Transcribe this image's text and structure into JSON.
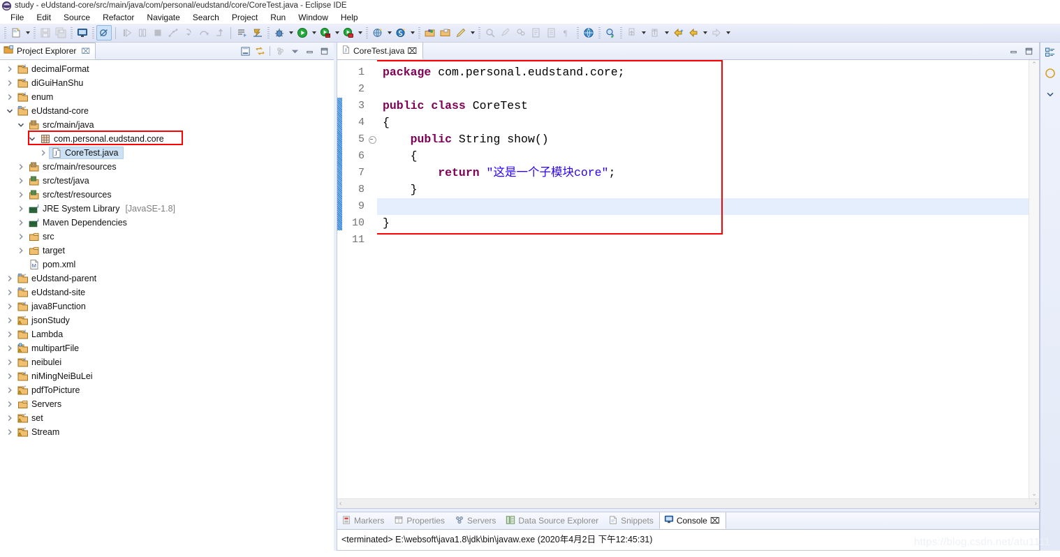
{
  "window": {
    "title": "study - eUdstand-core/src/main/java/com/personal/eudstand/core/CoreTest.java - Eclipse IDE",
    "app_icon": "eclipse-icon"
  },
  "menubar": {
    "items": [
      {
        "label": "File"
      },
      {
        "label": "Edit"
      },
      {
        "label": "Source"
      },
      {
        "label": "Refactor"
      },
      {
        "label": "Navigate"
      },
      {
        "label": "Search"
      },
      {
        "label": "Project"
      },
      {
        "label": "Run"
      },
      {
        "label": "Window"
      },
      {
        "label": "Help"
      }
    ]
  },
  "toolbar": {
    "groups": [
      {
        "buttons": [
          {
            "icon": "new-wizard-icon",
            "label": "New",
            "dropdown": true,
            "enabled": true,
            "active": false
          }
        ]
      },
      {
        "buttons": [
          {
            "icon": "save-icon",
            "label": "Save",
            "dropdown": false,
            "enabled": false,
            "active": false
          },
          {
            "icon": "save-all-icon",
            "label": "Save All",
            "dropdown": false,
            "enabled": false,
            "active": false
          }
        ]
      },
      {
        "buttons": [
          {
            "icon": "terminal-icon",
            "label": "Open Terminal",
            "dropdown": false,
            "enabled": true,
            "active": false
          }
        ]
      },
      {
        "buttons": [
          {
            "icon": "skip-breakpoints-icon",
            "label": "Skip All Breakpoints",
            "dropdown": false,
            "enabled": true,
            "active": true
          }
        ]
      },
      {
        "buttons": [
          {
            "icon": "resume-icon",
            "label": "Resume",
            "dropdown": false,
            "enabled": false,
            "active": false
          },
          {
            "icon": "suspend-icon",
            "label": "Suspend",
            "dropdown": false,
            "enabled": false,
            "active": false
          },
          {
            "icon": "terminate-icon",
            "label": "Terminate",
            "dropdown": false,
            "enabled": false,
            "active": false
          },
          {
            "icon": "disconnect-icon",
            "label": "Disconnect",
            "dropdown": false,
            "enabled": false,
            "active": false
          },
          {
            "icon": "step-into-icon",
            "label": "Step Into",
            "dropdown": false,
            "enabled": false,
            "active": false
          },
          {
            "icon": "step-over-icon",
            "label": "Step Over",
            "dropdown": false,
            "enabled": false,
            "active": false
          },
          {
            "icon": "step-return-icon",
            "label": "Step Return",
            "dropdown": false,
            "enabled": false,
            "active": false
          }
        ]
      },
      {
        "buttons": [
          {
            "icon": "next-annotation-icon",
            "label": "Next Annotation",
            "dropdown": false,
            "enabled": true,
            "active": false
          },
          {
            "icon": "last-edit-location-icon",
            "label": "Last Edit Location",
            "dropdown": false,
            "enabled": true,
            "active": false
          }
        ]
      },
      {
        "buttons": [
          {
            "icon": "debug-icon",
            "label": "Debug",
            "dropdown": true,
            "enabled": true,
            "active": false
          },
          {
            "icon": "run-icon",
            "label": "Run",
            "dropdown": true,
            "enabled": true,
            "active": false
          },
          {
            "icon": "run-external-tools-icon",
            "label": "External Tools",
            "dropdown": true,
            "enabled": true,
            "active": false
          },
          {
            "icon": "run-coverage-icon",
            "label": "Coverage",
            "dropdown": true,
            "enabled": true,
            "active": false
          }
        ]
      },
      {
        "buttons": [
          {
            "icon": "new-server-icon",
            "label": "New Server",
            "dropdown": false,
            "enabled": true,
            "active": false
          },
          {
            "icon": "new-web-project-icon",
            "label": "New Web Project",
            "dropdown": true,
            "enabled": true,
            "active": false
          },
          {
            "icon": "new-spring-icon",
            "label": "New Spring Element",
            "dropdown": true,
            "enabled": true,
            "active": false
          }
        ]
      },
      {
        "buttons": [
          {
            "icon": "new-java-package-icon",
            "label": "New Java Package",
            "dropdown": false,
            "enabled": true,
            "active": false
          },
          {
            "icon": "new-folder-icon",
            "label": "New Folder",
            "dropdown": false,
            "enabled": true,
            "active": false
          },
          {
            "icon": "new-class-icon",
            "label": "New Java Class",
            "dropdown": true,
            "enabled": true,
            "active": false
          }
        ]
      },
      {
        "buttons": [
          {
            "icon": "search-icon",
            "label": "Search",
            "dropdown": false,
            "enabled": false,
            "active": false
          },
          {
            "icon": "marker-icon",
            "label": "Toggle Marker",
            "dropdown": false,
            "enabled": false,
            "active": false
          },
          {
            "icon": "pin-icon",
            "label": "Pin Editor",
            "dropdown": false,
            "enabled": false,
            "active": false
          },
          {
            "icon": "open-task-icon",
            "label": "Open Task",
            "dropdown": false,
            "enabled": false,
            "active": false
          },
          {
            "icon": "block-selection-icon",
            "label": "Toggle Block Selection",
            "dropdown": false,
            "enabled": false,
            "active": false
          },
          {
            "icon": "whitespace-icon",
            "label": "Show Whitespace Characters",
            "dropdown": false,
            "enabled": false,
            "active": false
          }
        ]
      },
      {
        "buttons": [
          {
            "icon": "open-web-browser-icon",
            "label": "Open Web Browser",
            "dropdown": false,
            "enabled": true,
            "active": false
          }
        ]
      },
      {
        "buttons": [
          {
            "icon": "open-type-icon",
            "label": "Open Type",
            "dropdown": false,
            "enabled": true,
            "active": false
          }
        ]
      },
      {
        "buttons": [
          {
            "icon": "previous-annotation-icon",
            "label": "Previous Annotation",
            "dropdown": true,
            "enabled": false,
            "active": false
          },
          {
            "icon": "next-edit-icon",
            "label": "Next Annotation",
            "dropdown": true,
            "enabled": false,
            "active": false
          }
        ]
      },
      {
        "buttons": [
          {
            "icon": "back-history-icon",
            "label": "Back",
            "dropdown": false,
            "enabled": true,
            "active": false
          },
          {
            "icon": "back-icon",
            "label": "Back to",
            "dropdown": true,
            "enabled": true,
            "active": false
          },
          {
            "icon": "forward-icon",
            "label": "Forward",
            "dropdown": true,
            "enabled": false,
            "active": false
          }
        ]
      }
    ]
  },
  "project_explorer": {
    "tab_label": "Project Explorer",
    "tab_icon": "project-explorer-icon",
    "close_label": "⌧",
    "tools": [
      {
        "icon": "collapse-all-icon",
        "label": "Collapse All"
      },
      {
        "icon": "link-with-editor-icon",
        "label": "Link with Editor"
      },
      {
        "icon": "view-menu-dots-icon",
        "label": "View Menu"
      },
      {
        "icon": "view-menu-icon",
        "label": "View Menu"
      },
      {
        "icon": "minimize-icon",
        "label": "Minimize"
      },
      {
        "icon": "maximize-icon",
        "label": "Maximize"
      }
    ],
    "tree": [
      {
        "label": "decimalFormat",
        "indent": 0,
        "icon": "java-project-icon",
        "state": "collapsed"
      },
      {
        "label": "diGuiHanShu",
        "indent": 0,
        "icon": "java-project-icon",
        "state": "collapsed"
      },
      {
        "label": "enum",
        "indent": 0,
        "icon": "java-project-icon",
        "state": "collapsed"
      },
      {
        "label": "eUdstand-core",
        "indent": 0,
        "icon": "maven-project-icon",
        "state": "expanded"
      },
      {
        "label": "src/main/java",
        "indent": 1,
        "icon": "source-folder-icon",
        "state": "expanded"
      },
      {
        "label": "com.personal.eudstand.core",
        "indent": 2,
        "icon": "package-icon",
        "state": "expanded",
        "highlight_box": true
      },
      {
        "label": "CoreTest.java",
        "indent": 3,
        "icon": "java-file-icon",
        "state": "collapsed",
        "selected": true
      },
      {
        "label": "src/main/resources",
        "indent": 1,
        "icon": "source-folder-icon",
        "state": "collapsed"
      },
      {
        "label": "src/test/java",
        "indent": 1,
        "icon": "source-folder-green-icon",
        "state": "collapsed"
      },
      {
        "label": "src/test/resources",
        "indent": 1,
        "icon": "source-folder-green-icon",
        "state": "collapsed"
      },
      {
        "label": "JRE System Library",
        "suffix": "[JavaSE-1.8]",
        "indent": 1,
        "icon": "library-icon",
        "state": "collapsed"
      },
      {
        "label": "Maven Dependencies",
        "indent": 1,
        "icon": "library-icon",
        "state": "collapsed"
      },
      {
        "label": "src",
        "indent": 1,
        "icon": "folder-icon",
        "state": "collapsed"
      },
      {
        "label": "target",
        "indent": 1,
        "icon": "folder-icon",
        "state": "collapsed"
      },
      {
        "label": "pom.xml",
        "indent": 1,
        "icon": "maven-pom-icon",
        "state": "leaf"
      },
      {
        "label": "eUdstand-parent",
        "indent": 0,
        "icon": "maven-project-icon",
        "state": "collapsed"
      },
      {
        "label": "eUdstand-site",
        "indent": 0,
        "icon": "maven-project-icon",
        "state": "collapsed"
      },
      {
        "label": "java8Function",
        "indent": 0,
        "icon": "java-project-icon",
        "state": "collapsed"
      },
      {
        "label": "jsonStudy",
        "indent": 0,
        "icon": "java-project-warning-icon",
        "state": "collapsed"
      },
      {
        "label": "Lambda",
        "indent": 0,
        "icon": "java-project-icon",
        "state": "collapsed"
      },
      {
        "label": "multipartFile",
        "indent": 0,
        "icon": "web-project-warning-icon",
        "state": "collapsed"
      },
      {
        "label": "neibulei",
        "indent": 0,
        "icon": "java-project-icon",
        "state": "collapsed"
      },
      {
        "label": "niMingNeiBuLei",
        "indent": 0,
        "icon": "java-project-icon",
        "state": "collapsed"
      },
      {
        "label": "pdfToPicture",
        "indent": 0,
        "icon": "java-project-warning-icon",
        "state": "collapsed"
      },
      {
        "label": "Servers",
        "indent": 0,
        "icon": "folder-icon",
        "state": "collapsed"
      },
      {
        "label": "set",
        "indent": 0,
        "icon": "java-project-warning-icon",
        "state": "collapsed"
      },
      {
        "label": "Stream",
        "indent": 0,
        "icon": "java-project-warning-icon",
        "state": "collapsed"
      }
    ]
  },
  "editor": {
    "tab_label": "CoreTest.java",
    "tab_icon": "java-file-icon",
    "close_label": "⌧",
    "tools": [
      {
        "icon": "minimize-icon",
        "label": "Minimize"
      },
      {
        "icon": "maximize-icon",
        "label": "Maximize"
      }
    ],
    "line_numbers": [
      "1",
      "2",
      "3",
      "4",
      "5",
      "6",
      "7",
      "8",
      "9",
      "10",
      "11"
    ],
    "fold_marker_line": 5,
    "cursor_line": 9,
    "red_box": true,
    "lines": [
      {
        "n": 1,
        "tokens": [
          {
            "t": "package",
            "c": "k"
          },
          {
            "t": " com.personal.eudstand.core;",
            "c": "p"
          }
        ]
      },
      {
        "n": 2,
        "tokens": []
      },
      {
        "n": 3,
        "tokens": [
          {
            "t": "public",
            "c": "k"
          },
          {
            "t": " ",
            "c": "p"
          },
          {
            "t": "class",
            "c": "k"
          },
          {
            "t": " CoreTest",
            "c": "p"
          }
        ]
      },
      {
        "n": 4,
        "tokens": [
          {
            "t": "{",
            "c": "p"
          }
        ]
      },
      {
        "n": 5,
        "tokens": [
          {
            "t": "    ",
            "c": "p"
          },
          {
            "t": "public",
            "c": "k"
          },
          {
            "t": " String show()",
            "c": "p"
          }
        ]
      },
      {
        "n": 6,
        "tokens": [
          {
            "t": "    {",
            "c": "p"
          }
        ]
      },
      {
        "n": 7,
        "tokens": [
          {
            "t": "        ",
            "c": "p"
          },
          {
            "t": "return",
            "c": "k"
          },
          {
            "t": " ",
            "c": "p"
          },
          {
            "t": "\"这是一个子模块core\"",
            "c": "s"
          },
          {
            "t": ";",
            "c": "p"
          }
        ]
      },
      {
        "n": 8,
        "tokens": [
          {
            "t": "    }",
            "c": "p"
          }
        ]
      },
      {
        "n": 9,
        "tokens": []
      },
      {
        "n": 10,
        "tokens": [
          {
            "t": "}",
            "c": "p"
          }
        ]
      },
      {
        "n": 11,
        "tokens": []
      }
    ],
    "scroll_up": "⌃",
    "scroll_down": "⌄",
    "scroll_left": "‹",
    "scroll_right": "›"
  },
  "bottom_panel": {
    "tabs": [
      {
        "label": "Markers",
        "icon": "markers-icon",
        "active": false
      },
      {
        "label": "Properties",
        "icon": "properties-icon",
        "active": false
      },
      {
        "label": "Servers",
        "icon": "servers-icon",
        "active": false
      },
      {
        "label": "Data Source Explorer",
        "icon": "data-source-explorer-icon",
        "active": false
      },
      {
        "label": "Snippets",
        "icon": "snippets-icon",
        "active": false
      },
      {
        "label": "Console",
        "icon": "console-icon",
        "active": true,
        "close_label": "⌧"
      }
    ],
    "console_output": "<terminated> E:\\websoft\\java1.8\\jdk\\bin\\javaw.exe (2020年4月2日 下午12:45:31)"
  },
  "outline_bar": {
    "buttons": [
      {
        "icon": "outline-restore-icon",
        "label": "Restore"
      },
      {
        "icon": "outline-view-icon",
        "label": "Outline"
      },
      {
        "icon": "chevron-down-icon",
        "label": "Expand"
      }
    ]
  },
  "watermark": {
    "text": "https://blog.csdn.net/atu1111"
  },
  "colors": {
    "accent_red": "#ff0000",
    "selection_blue": "#cde1f5",
    "cursor_line": "#e4eefc",
    "keyword": "#7f0055",
    "string": "#2a00ff",
    "toolbar_bg": "#e3e8f7"
  }
}
